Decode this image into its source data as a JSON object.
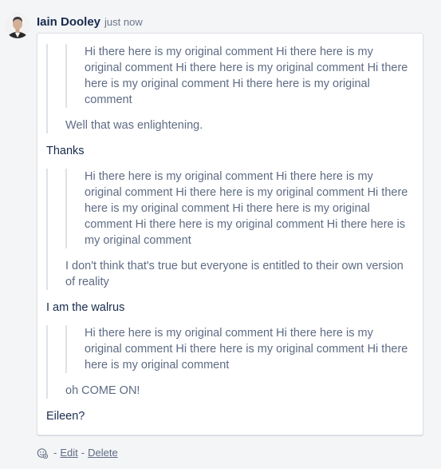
{
  "comment": {
    "author": "Iain Dooley",
    "timestamp": "just now",
    "body": {
      "quote_1": {
        "nested_quote": "Hi there here is my original comment Hi there here is my original comment Hi there here is my original comment Hi there here is my original comment Hi there here is my original comment",
        "reply": "Well that was enlightening."
      },
      "text_1": "Thanks",
      "quote_2": {
        "nested_quote": "Hi there here is my original comment Hi there here is my original comment Hi there here is my original comment Hi there here is my original comment Hi there here is my original comment Hi there here is my original comment Hi there here is my original comment",
        "reply": "I don't think that's true but everyone is entitled to their own version of reality"
      },
      "text_2": "I am the walrus",
      "quote_3": {
        "nested_quote": "Hi there here is my original comment Hi there here is my original comment Hi there here is my original comment Hi there here is my original comment",
        "reply": "oh COME ON!"
      },
      "text_3": "Eileen?"
    },
    "actions": {
      "separator": "-",
      "edit_label": "Edit",
      "delete_label": "Delete"
    }
  },
  "icons": {
    "avatar": "avatar",
    "reaction": "add-reaction-icon"
  },
  "colors": {
    "author": "#172b4d",
    "meta": "#6b778c",
    "quote_text": "#5e6c84",
    "quote_border": "#dfe1e6",
    "card_border": "#dcdfe4"
  }
}
